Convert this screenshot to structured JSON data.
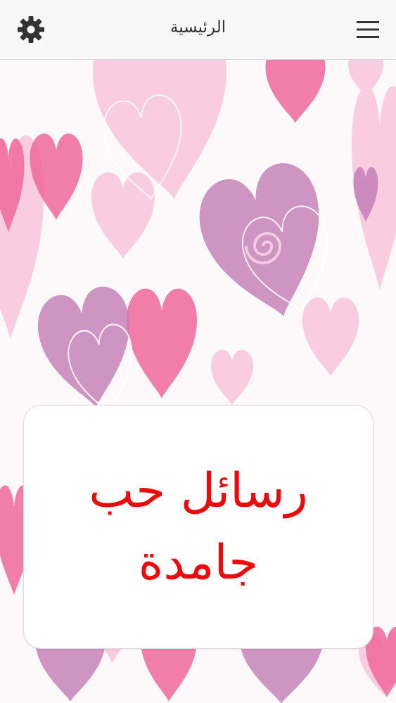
{
  "header": {
    "title": "الرئيسية"
  },
  "card": {
    "text": "رسائل حب\nجامدة"
  },
  "colors": {
    "accent_text": "#ee0a0a",
    "header_bg": "#f7f7f7",
    "heart_pink": "#f06fa0",
    "heart_light": "#f8c6da",
    "heart_purple": "#c27bb5"
  },
  "icons": {
    "settings": "gear-icon",
    "menu": "hamburger-menu-icon"
  }
}
